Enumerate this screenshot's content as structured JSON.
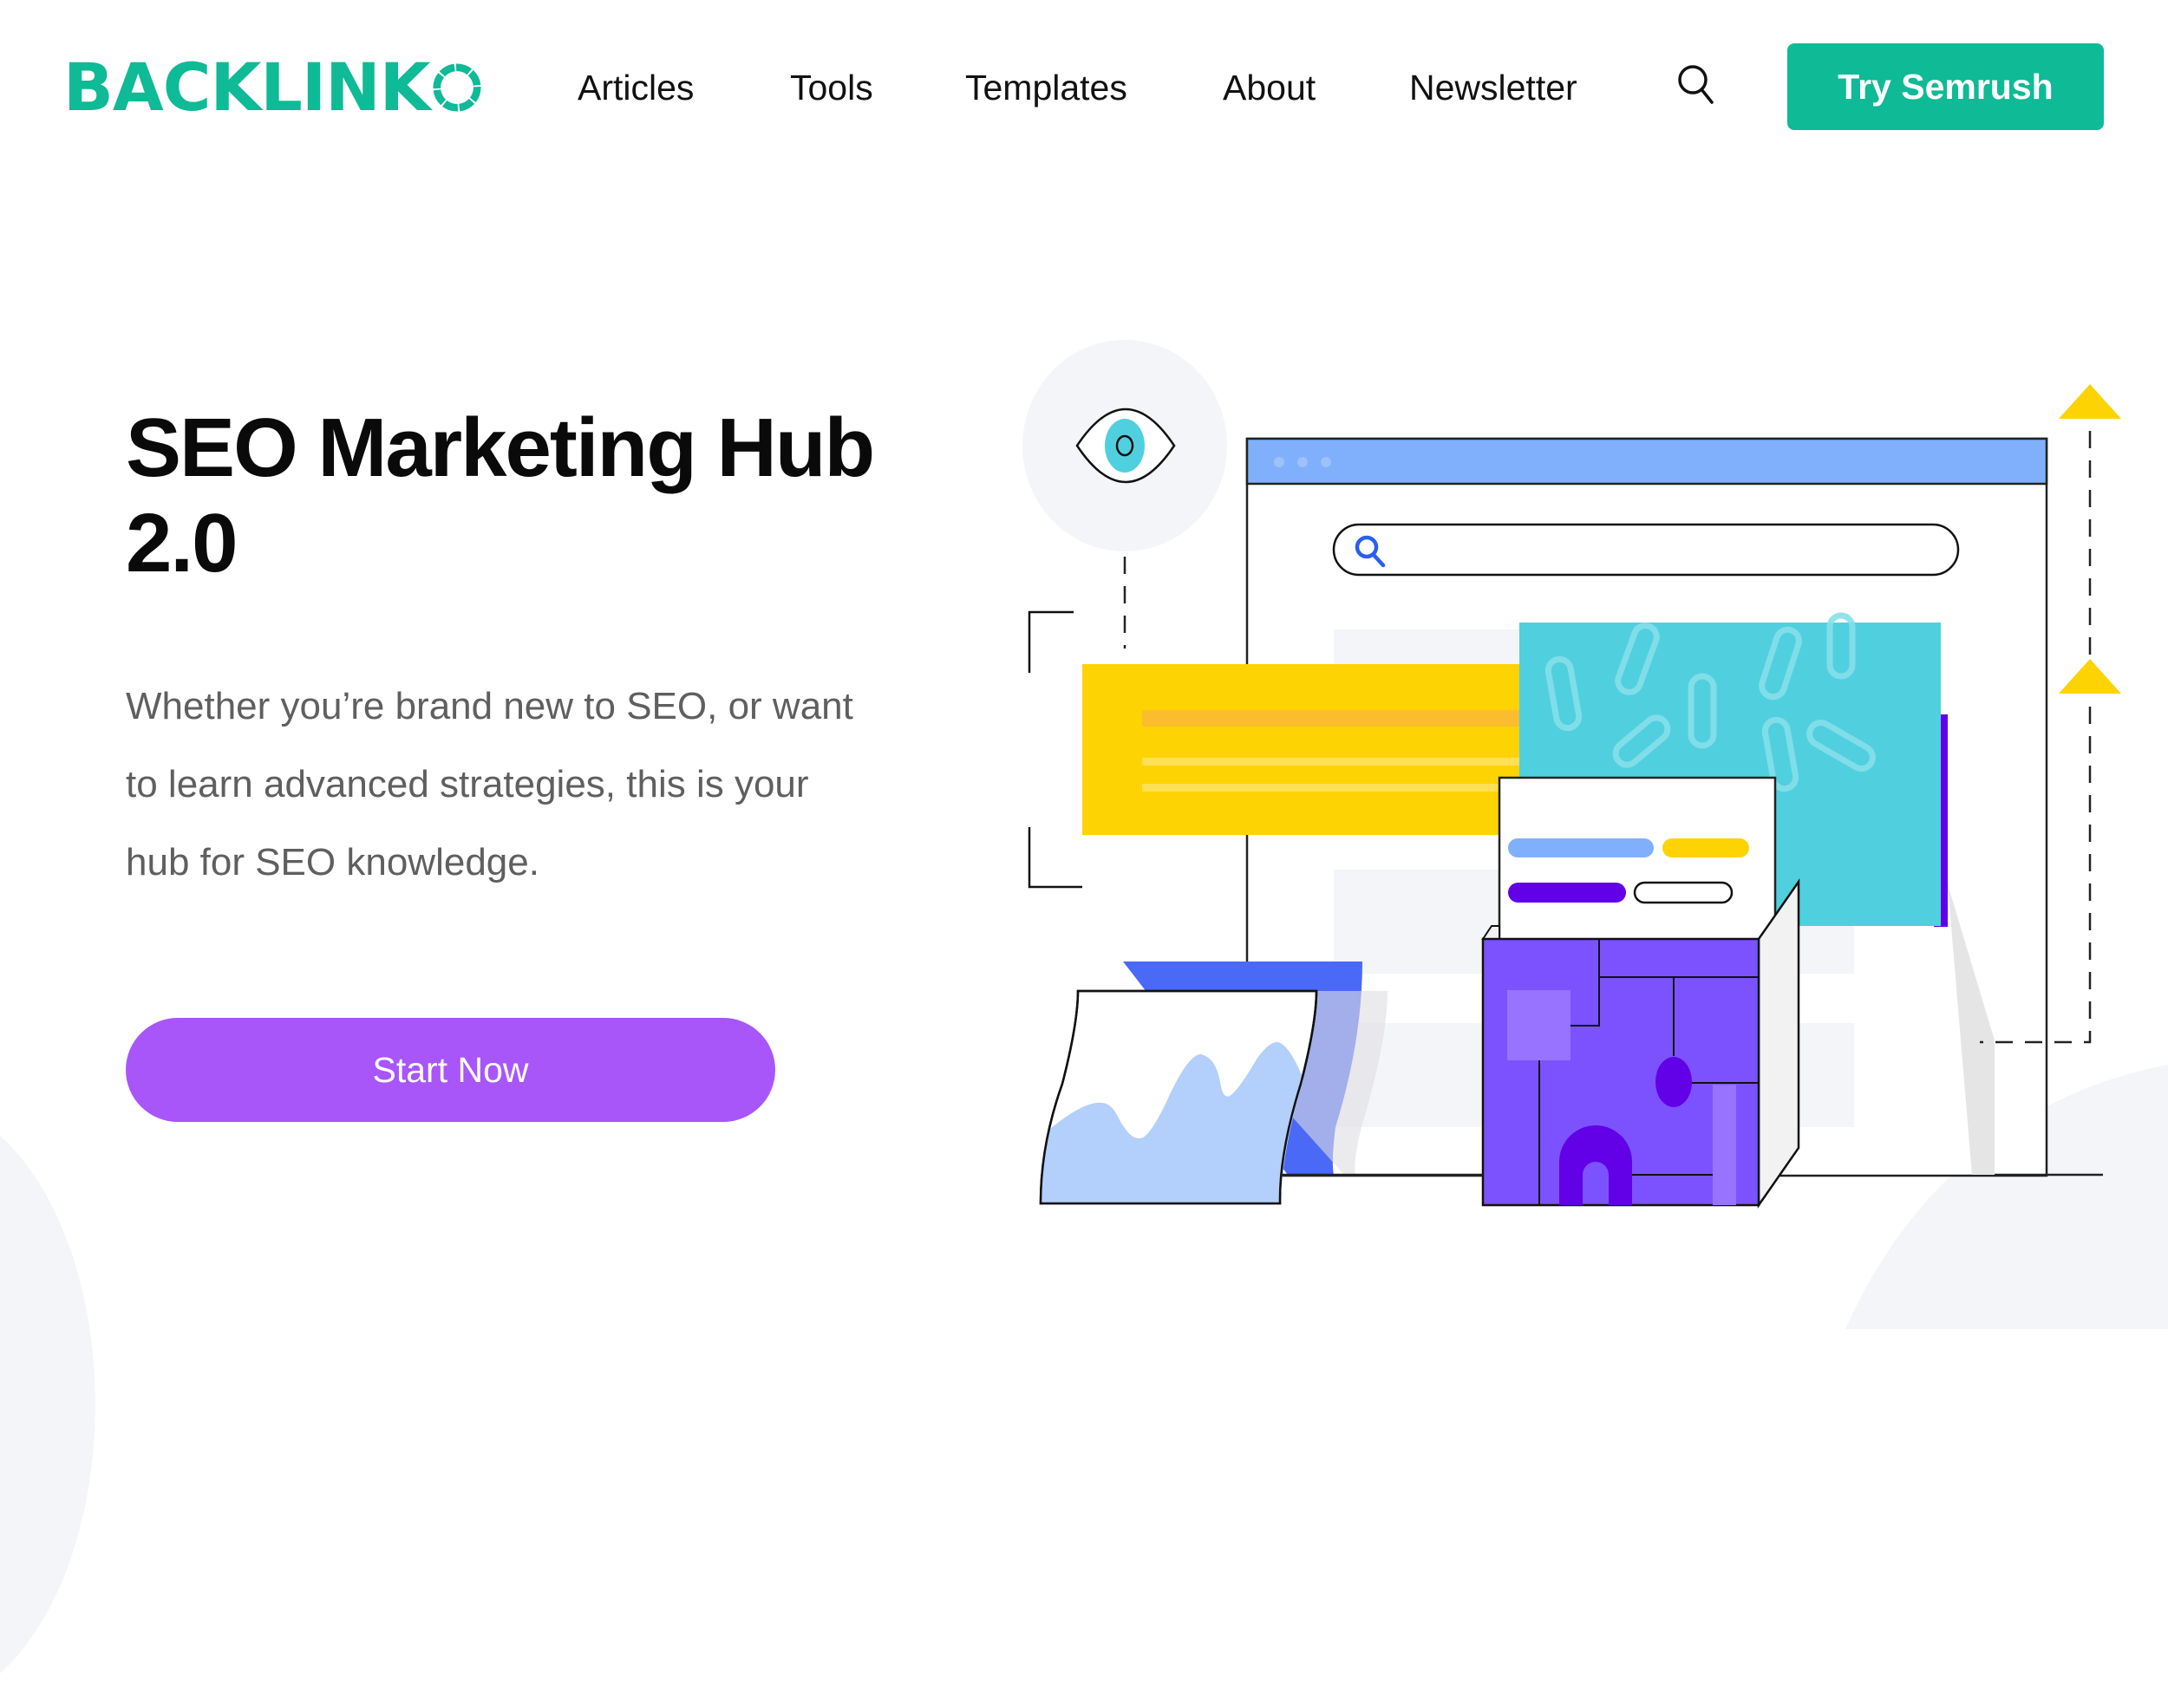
{
  "header": {
    "logo_text": "BACKLINK",
    "logo_alt": "BACKLINKO",
    "nav": [
      {
        "label": "Articles"
      },
      {
        "label": "Tools"
      },
      {
        "label": "Templates"
      },
      {
        "label": "About"
      },
      {
        "label": "Newsletter"
      }
    ],
    "search_icon": "search-icon",
    "cta_label": "Try Semrush"
  },
  "hero": {
    "title": "SEO Marketing Hub 2.0",
    "description": "Whether you’re brand new to SEO, or want to learn advanced strategies, this is your hub for SEO knowledge.",
    "start_label": "Start Now"
  },
  "illustration": {
    "icons": [
      "eye-icon",
      "browser-window",
      "search-bar",
      "link-pattern-card",
      "content-card",
      "box",
      "chart-card",
      "arrow-up-icon",
      "arrow-up-icon"
    ]
  },
  "colors": {
    "brand": "#0fba96",
    "start_button": "#a855fa",
    "browser_bar": "#80b0fc",
    "yellow": "#fdd303",
    "cyan": "#50cfdf",
    "violet": "#7c52ff",
    "deep_violet": "#6200e8",
    "light_blue": "#b3cffb",
    "royal_blue": "#4a69f7"
  }
}
